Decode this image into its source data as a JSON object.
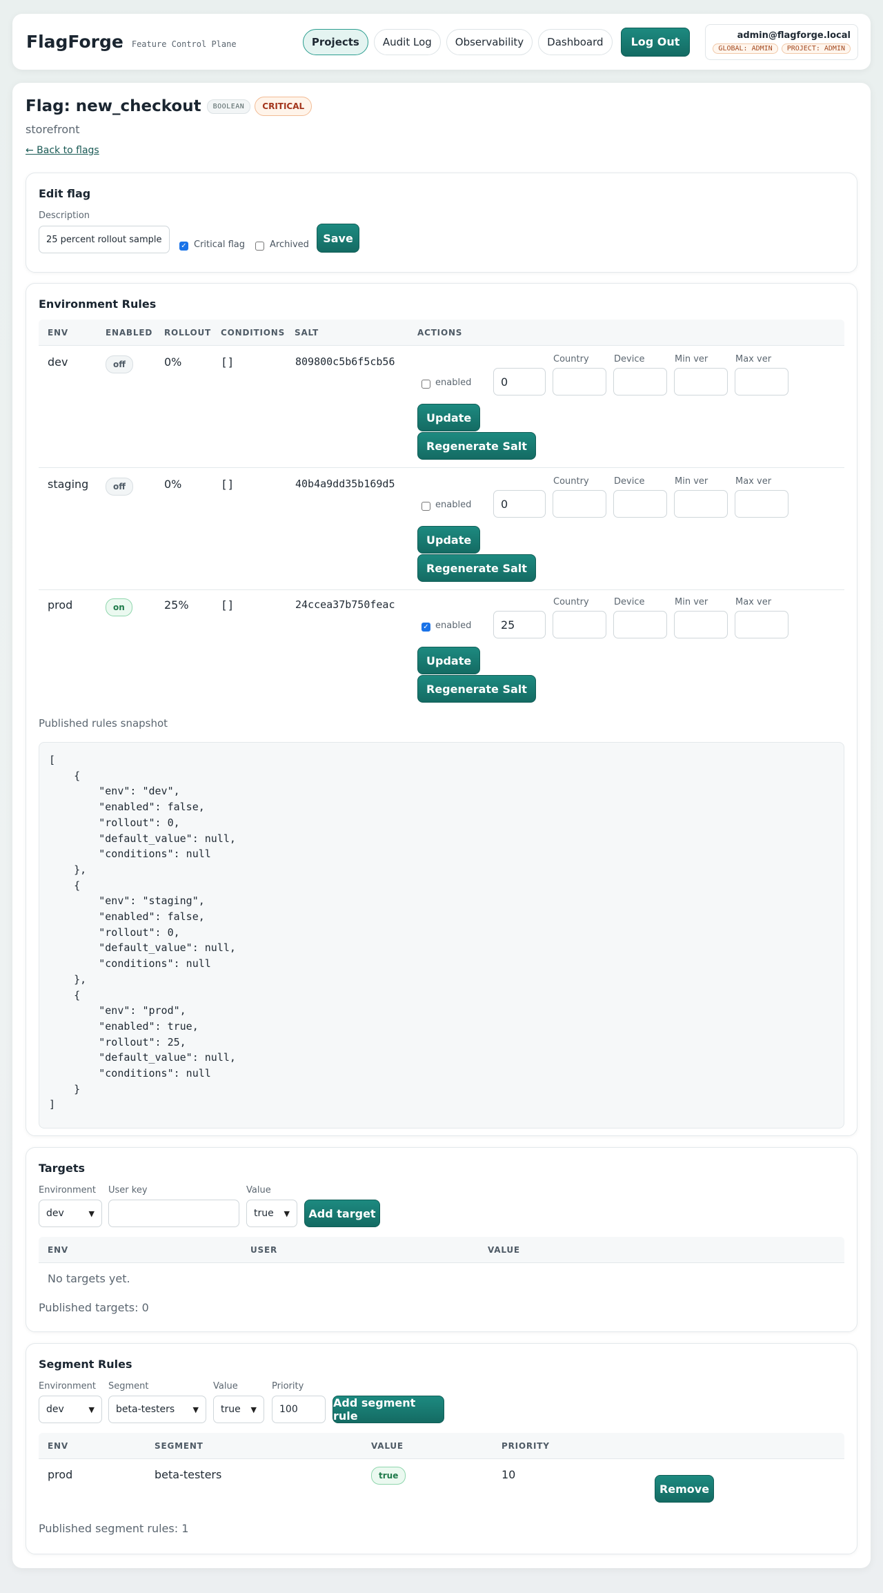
{
  "header": {
    "brand": "FlagForge",
    "tagline": "Feature Control Plane",
    "nav": [
      "Projects",
      "Audit Log",
      "Observability",
      "Dashboard"
    ],
    "logout_label": "Log Out",
    "user_email": "admin@flagforge.local",
    "roles": [
      "GLOBAL: ADMIN",
      "PROJECT: ADMIN"
    ]
  },
  "flag": {
    "title": "Flag: new_checkout",
    "type_badge": "BOOLEAN",
    "critical_badge": "CRITICAL",
    "project": "storefront",
    "back_link": "← Back to flags"
  },
  "edit": {
    "heading": "Edit flag",
    "description_label": "Description",
    "description_value": "25 percent rollout sample",
    "critical_label": "Critical flag",
    "critical_checked": true,
    "archived_label": "Archived",
    "archived_checked": false,
    "save_label": "Save"
  },
  "env_rules": {
    "heading": "Environment Rules",
    "columns": [
      "ENV",
      "ENABLED",
      "ROLLOUT",
      "CONDITIONS",
      "SALT",
      "ACTIONS"
    ],
    "field_labels": {
      "enabled": "enabled",
      "country": "Country",
      "device": "Device",
      "min_ver": "Min ver",
      "max_ver": "Max ver"
    },
    "update_label": "Update",
    "regen_label": "Regenerate Salt",
    "rows": [
      {
        "env": "dev",
        "enabled": "off",
        "rollout": "0%",
        "conditions": "[]",
        "salt": "809800c5b6f5cb56",
        "enabled_checked": false,
        "rollout_input": "0"
      },
      {
        "env": "staging",
        "enabled": "off",
        "rollout": "0%",
        "conditions": "[]",
        "salt": "40b4a9dd35b169d5",
        "enabled_checked": false,
        "rollout_input": "0"
      },
      {
        "env": "prod",
        "enabled": "on",
        "rollout": "25%",
        "conditions": "[]",
        "salt": "24ccea37b750feac",
        "enabled_checked": true,
        "rollout_input": "25"
      }
    ],
    "snapshot_label": "Published rules snapshot",
    "snapshot_text": "[\n    {\n        \"env\": \"dev\",\n        \"enabled\": false,\n        \"rollout\": 0,\n        \"default_value\": null,\n        \"conditions\": null\n    },\n    {\n        \"env\": \"staging\",\n        \"enabled\": false,\n        \"rollout\": 0,\n        \"default_value\": null,\n        \"conditions\": null\n    },\n    {\n        \"env\": \"prod\",\n        \"enabled\": true,\n        \"rollout\": 25,\n        \"default_value\": null,\n        \"conditions\": null\n    }\n]"
  },
  "targets": {
    "heading": "Targets",
    "env_label": "Environment",
    "env_value": "dev",
    "user_key_label": "User key",
    "user_key_value": "",
    "value_label": "Value",
    "value_value": "true",
    "add_label": "Add target",
    "columns": [
      "ENV",
      "USER",
      "VALUE"
    ],
    "empty_text": "No targets yet.",
    "published": "Published targets: 0"
  },
  "segments": {
    "heading": "Segment Rules",
    "env_label": "Environment",
    "env_value": "dev",
    "segment_label": "Segment",
    "segment_value": "beta-testers",
    "value_label": "Value",
    "value_value": "true",
    "priority_label": "Priority",
    "priority_value": "100",
    "add_label": "Add segment rule",
    "columns": [
      "ENV",
      "SEGMENT",
      "VALUE",
      "PRIORITY"
    ],
    "rows": [
      {
        "env": "prod",
        "segment": "beta-testers",
        "value": "true",
        "priority": "10"
      }
    ],
    "remove_label": "Remove",
    "published": "Published segment rules: 1"
  }
}
